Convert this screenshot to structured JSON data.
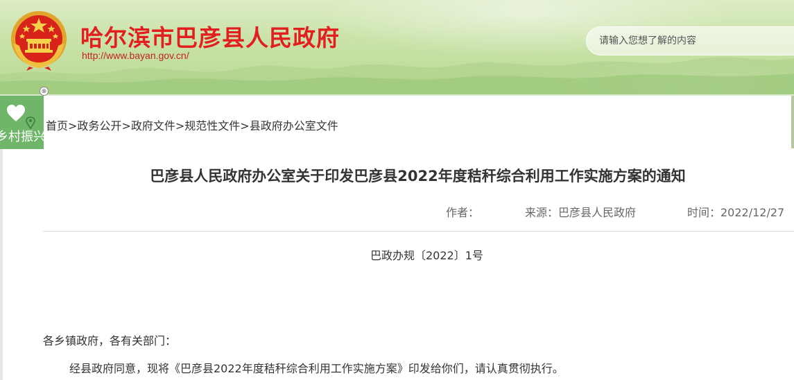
{
  "header": {
    "site_title": "哈尔滨市巴彦县人民政府",
    "site_url": "http://www.bayan.gov.cn/",
    "search_placeholder": "请输入您想了解的内容",
    "accent_color": "#e21e1e"
  },
  "side_widget": {
    "label": "乡村振兴",
    "close_symbol": "⊗",
    "icons": [
      "heart-icon",
      "location-pin-icon"
    ],
    "color": "#6fb56a"
  },
  "breadcrumb": {
    "items": [
      "首页",
      "政务公开",
      "政府文件",
      "规范性文件",
      "县政府办公室文件"
    ],
    "separator": ">"
  },
  "article": {
    "title": "巴彦县人民政府办公室关于印发巴彦县2022年度秸秆综合利用工作实施方案的通知",
    "author_label": "作者：",
    "source_label": "来源：巴彦县人民政府",
    "time_label": "时间：2022/12/27",
    "doc_number": "巴政办规〔2022〕1号",
    "salutation": "各乡镇政府，各有关部门：",
    "paragraph_1": "经县政府同意，现将《巴彦县2022年度秸秆综合利用工作实施方案》印发给你们，请认真贯彻执行。"
  }
}
